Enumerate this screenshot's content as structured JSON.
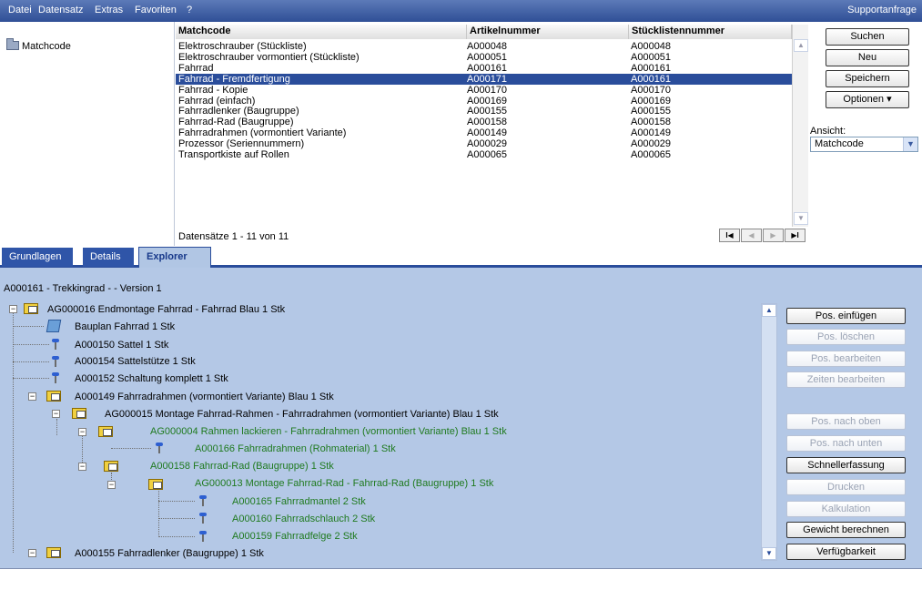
{
  "menu": {
    "items": [
      "Datei",
      "Datensatz",
      "Extras",
      "Favoriten",
      "?"
    ],
    "support": "Supportanfrage"
  },
  "tree": {
    "root": "Matchcode"
  },
  "grid": {
    "columns": [
      "Matchcode",
      "Artikelnummer",
      "Stücklistennummer"
    ],
    "rows": [
      [
        "Elektroschrauber (Stückliste)",
        "A000048",
        "A000048"
      ],
      [
        "Elektroschrauber vormontiert (Stückliste)",
        "A000051",
        "A000051"
      ],
      [
        "Fahrrad",
        "A000161",
        "A000161"
      ],
      [
        "Fahrrad - Fremdfertigung",
        "A000171",
        "A000161"
      ],
      [
        "Fahrrad - Kopie",
        "A000170",
        "A000170"
      ],
      [
        "Fahrrad (einfach)",
        "A000169",
        "A000169"
      ],
      [
        "Fahrradlenker (Baugruppe)",
        "A000155",
        "A000155"
      ],
      [
        "Fahrrad-Rad (Baugruppe)",
        "A000158",
        "A000158"
      ],
      [
        "Fahrradrahmen (vormontiert Variante)",
        "A000149",
        "A000149"
      ],
      [
        "Prozessor (Seriennummern)",
        "A000029",
        "A000029"
      ],
      [
        "Transportkiste auf Rollen",
        "A000065",
        "A000065"
      ]
    ],
    "selected_index": 3,
    "status": "Datensätze 1 - 11 von 11",
    "nav": [
      "I◀",
      "◀",
      "▶",
      "▶I"
    ]
  },
  "actions": {
    "search": "Suchen",
    "new": "Neu",
    "save": "Speichern",
    "options": "Optionen ▾"
  },
  "view": {
    "label": "Ansicht:",
    "value": "Matchcode"
  },
  "tabs": [
    "Grundlagen",
    "Details",
    "Explorer"
  ],
  "active_tab": "Explorer",
  "explorer": {
    "version": "A000161 - Trekkingrad - - Version 1",
    "nodes": [
      "AG000016 Endmontage Fahrrad - Fahrrad Blau 1 Stk",
      "Bauplan Fahrrad 1 Stk",
      "A000150 Sattel 1 Stk",
      "A000154 Sattelstütze 1 Stk",
      "A000152 Schaltung komplett 1 Stk",
      "A000149 Fahrradrahmen (vormontiert Variante) Blau 1 Stk",
      "AG000015 Montage Fahrrad-Rahmen - Fahrradrahmen (vormontiert Variante) Blau 1 Stk",
      "AG000004 Rahmen lackieren - Fahrradrahmen (vormontiert Variante) Blau 1 Stk",
      "A000166 Fahrradrahmen (Rohmaterial) 1 Stk",
      "A000158 Fahrrad-Rad (Baugruppe) 1 Stk",
      "AG000013 Montage Fahrrad-Rad - Fahrrad-Rad (Baugruppe) 1 Stk",
      "A000165 Fahrradmantel 2 Stk",
      "A000160 Fahrradschlauch 2 Stk",
      "A000159 Fahrradfelge 2 Stk",
      "A000155 Fahrradlenker (Baugruppe) 1 Stk"
    ],
    "buttons": [
      "Pos. einfügen",
      "Pos. löschen",
      "Pos. bearbeiten",
      "Zeiten bearbeiten",
      "Pos. nach oben",
      "Pos. nach unten",
      "Schnellerfassung",
      "Drucken",
      "Kalkulation",
      "Gewicht berechnen",
      "Verfügbarkeit"
    ]
  },
  "colors": {
    "menubar": "#2f4f96",
    "selection": "#2a4d9b",
    "explorer_bg": "#b4c8e6",
    "green_text": "#1f7a1f"
  }
}
